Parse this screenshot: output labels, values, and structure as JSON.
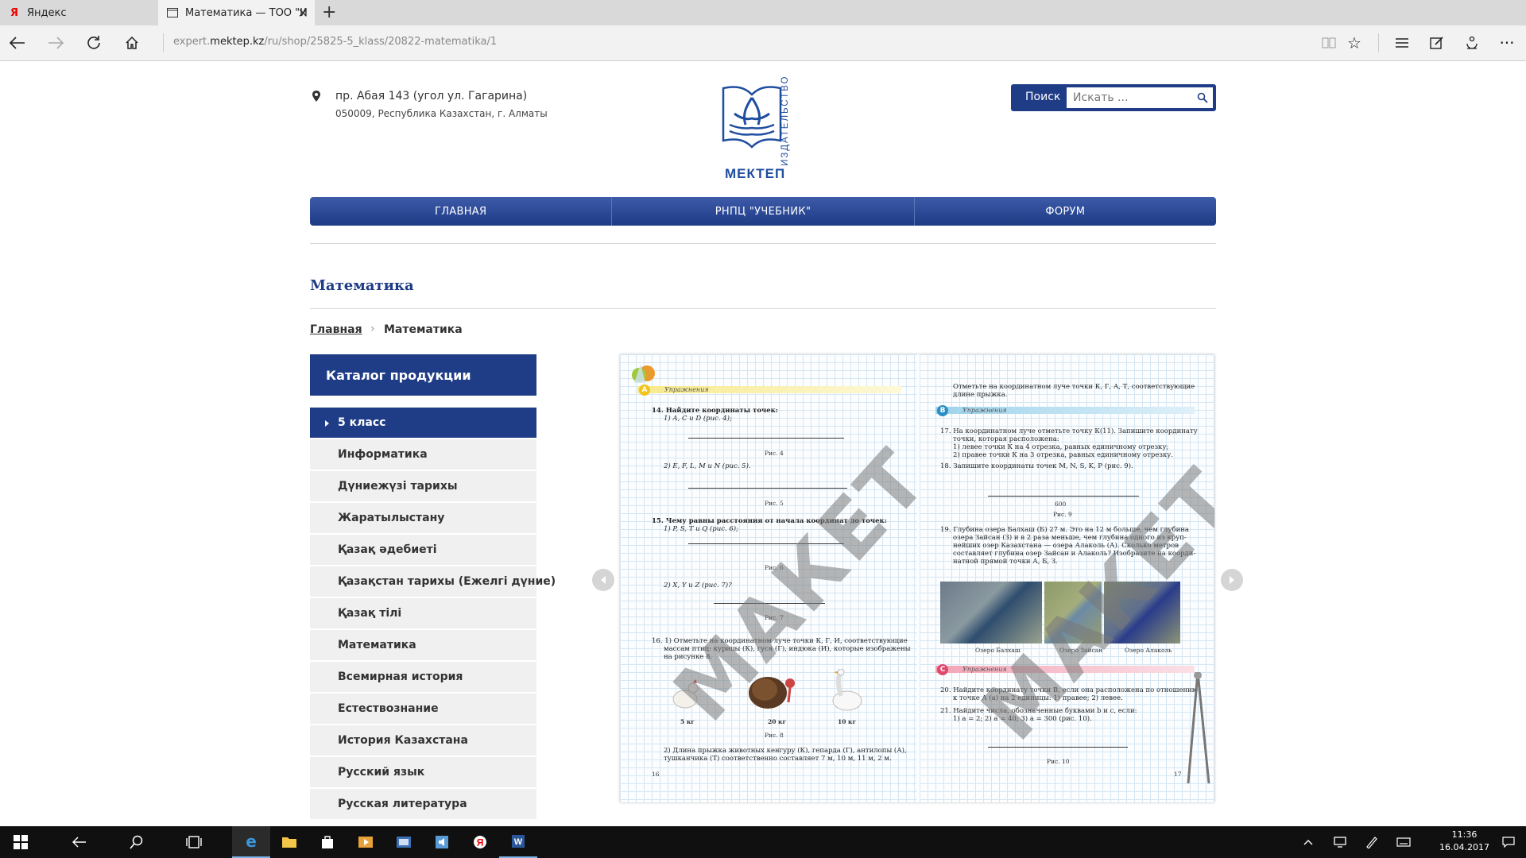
{
  "browser": {
    "tabs": [
      {
        "label": "Яндекс",
        "icon": "yandex-icon"
      },
      {
        "label": "Математика — ТОО \"И",
        "icon": "page-icon",
        "active": true
      }
    ],
    "url_prefix": "expert.",
    "url_domain": "mektep.kz",
    "url_path": "/ru/shop/25825-5_klass/20822-matematika/1"
  },
  "header": {
    "address_line1": "пр. Абая 143 (угол ул. Гагарина)",
    "address_line2": "050009, Республика Казахстан, г. Алматы",
    "logo_name": "МЕКТЕП",
    "logo_vertical": "ИЗДАТЕЛЬСТВО",
    "search_label": "Поиск",
    "search_placeholder": "Искать ..."
  },
  "menu": {
    "items": [
      "ГЛАВНАЯ",
      "РНПЦ \"УЧЕБНИК\"",
      "ФОРУМ"
    ]
  },
  "page": {
    "title": "Математика",
    "breadcrumb_home": "Главная",
    "breadcrumb_current": "Математика"
  },
  "catalog": {
    "title": "Каталог продукции",
    "items": [
      "5 класс",
      "Информатика",
      "Дүниежүзі тарихы",
      "Жаратылыстану",
      "Қазақ әдебиеті",
      "Қазақстан тарихы (Ежелгі дүние)",
      "Қазақ тілі",
      "Математика",
      "Всемирная история",
      "Естествознание",
      "История Казахстана",
      "Русский язык",
      "Русская литература"
    ]
  },
  "book": {
    "watermark": "МАКЕТ",
    "left": {
      "section_letter": "A",
      "section_title": "Упражнения",
      "t14": "14. Найдите координаты точек:",
      "t14a": "1) A, C и D (рис. 4);",
      "fig4": "Рис. 4",
      "t14b": "2) E, F, L, M и N (рис. 5).",
      "fig5": "Рис. 5",
      "t15": "15. Чему равны расстояния от начала координат до точек:",
      "t15a": "1) P, S, T и Q (рис. 6);",
      "fig6": "Рис. 6",
      "t15b": "2) X, Y и Z (рис. 7)?",
      "fig7": "Рис. 7",
      "t16a": "16. 1) Отметьте на координатном луче точки К, Г, И, соответствующие",
      "t16b": "массам птиц: курицы (К), гуся (Г), индюка (И), которые изображены",
      "t16c": "на рисунке 8.",
      "bird1": "5 кг",
      "bird2": "20 кг",
      "bird3": "10 кг",
      "fig8": "Рис. 8",
      "t16d": "2) Длина прыжка животных кенгуру (К), гепарда (Г), антилопы (А),",
      "t16e": "тушканчика (Т) соответственно составляет 7 м, 10 м, 11 м, 2 м.",
      "pagenum": "16"
    },
    "right": {
      "top1": "Отметьте на координатном луче точки К, Г, А, Т, соответствующие",
      "top2": "длине прыжка.",
      "section_letter": "B",
      "section_title": "Упражнения",
      "t17": "17. На координатном луче отметьте точку К(11). Запишите координату",
      "t17a": "точки, которая расположена:",
      "t17b": "1) левее точки К на 4 отрезка, равных единичному отрезку;",
      "t17c": "2) правее точки К на 3 отрезка, равных единичному отрезку.",
      "t18": "18. Запишите координаты точек M, N, S, K, P (рис. 9).",
      "tick600": "600",
      "fig9": "Рис. 9",
      "t19a": "19. Глубина озера Балхаш (Б) 27 м. Это на 12 м больше, чем глубина",
      "t19b": "озера Зайсан (З) и в 2 раза меньше, чем глубина одного из круп-",
      "t19c": "нейших озер Казахстана — озера Алаколь (А). Сколько метров",
      "t19d": "составляет глубина озер Зайсан и Алаколь? Изобразите на коорди-",
      "t19e": "натной прямой точки А, Б, З.",
      "lake1": "Озеро Балхаш",
      "lake2": "Озеро Зайсан",
      "lake3": "Озеро Алаколь",
      "section2_letter": "C",
      "section2_title": "Упражнения",
      "t20a": "20. Найдите координату точки B, если она расположена по отношению",
      "t20b": "к точке A (а) на 2 единицы: 1) правее; 2) левее.",
      "t21a": "21. Найдите числа, обозначенные буквами b и c, если:",
      "t21b": "1) a = 2; 2) a = 40; 3) a = 300 (рис. 10).",
      "fig10": "Рис. 10",
      "pagenum": "17"
    }
  },
  "taskbar": {
    "time": "11:36",
    "date": "16.04.2017"
  }
}
